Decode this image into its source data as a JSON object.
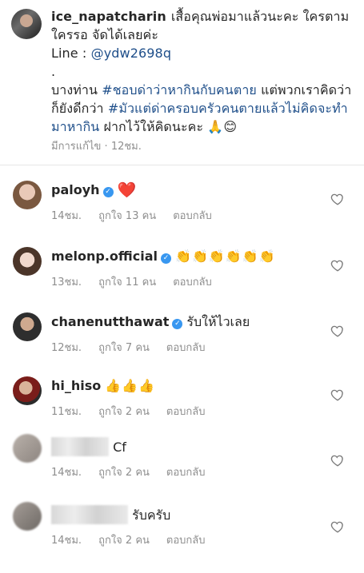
{
  "caption": {
    "username": "ice_napatcharin",
    "line1": "เสื้อคุณพ่อมาแล้วนะคะ ใครตาม",
    "line2": "ใครรอ จัดได้เลยค่ะ",
    "line3_prefix": "Line : ",
    "line3_link": "@ydw2698q",
    "line4": ".",
    "line5_pre": "บางท่าน ",
    "line5_tag": "#ชอบด่าว่าหากินกับคนตาย",
    "line5_post": " แต่พวกเราคิดว่า",
    "line6_pre": "ก็ยังดีกว่า ",
    "line6_tag": "#มัวแต่ด่าครอบครัวคนตายแล้วไม่คิดจะทำ",
    "line7_tag": "มาหากิน",
    "line7_post": " ฝากไว้ให้คิดนะคะ 🙏😊",
    "edited": "มีการแก้ไข",
    "time": "12ชม."
  },
  "comments": [
    {
      "username": "paloyh",
      "text": "❤️",
      "time": "14ชม.",
      "likes": "ถูกใจ 13 คน",
      "reply": "ตอบกลับ"
    },
    {
      "username": "melonp.official",
      "text": "👏👏👏👏👏👏",
      "time": "13ชม.",
      "likes": "ถูกใจ 11 คน",
      "reply": "ตอบกลับ"
    },
    {
      "username": "chanenutthawat",
      "text": "รับให้ไวเลย",
      "time": "12ชม.",
      "likes": "ถูกใจ 7 คน",
      "reply": "ตอบกลับ"
    },
    {
      "username": "hi_hiso",
      "text": "👍👍👍",
      "time": "11ชม.",
      "likes": "ถูกใจ 2 คน",
      "reply": "ตอบกลับ"
    },
    {
      "username": "",
      "text": "Cf",
      "time": "14ชม.",
      "likes": "ถูกใจ 2 คน",
      "reply": "ตอบกลับ"
    },
    {
      "username": "",
      "text": "รับครับ",
      "time": "14ชม.",
      "likes": "ถูกใจ 2 คน",
      "reply": "ตอบกลับ"
    }
  ],
  "icons": {
    "verified": "verified-badge-icon",
    "like": "heart-outline-icon"
  },
  "colors": {
    "link": "#1f4f8a",
    "verified": "#3897f0",
    "meta": "#8e8e8e"
  }
}
